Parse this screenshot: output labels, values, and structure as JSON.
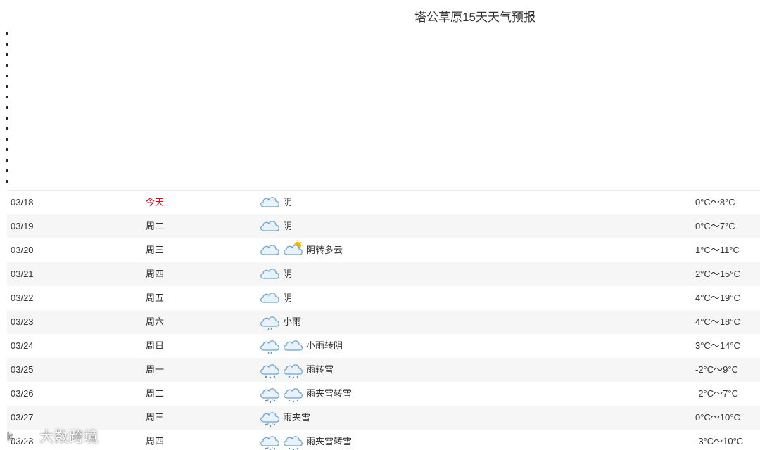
{
  "title": "塔公草原15天天气预报",
  "watermark": "大数跨境",
  "rows": [
    {
      "date": "03/18",
      "day": "今天",
      "today": true,
      "icons": [
        "cloud-icon"
      ],
      "weather": "阴",
      "temp": "0°C～8°C"
    },
    {
      "date": "03/19",
      "day": "周二",
      "icons": [
        "cloud-icon"
      ],
      "weather": "阴",
      "temp": "0°C～7°C"
    },
    {
      "date": "03/20",
      "day": "周三",
      "icons": [
        "cloud-icon",
        "sun-cloud-icon"
      ],
      "weather": "阴转多云",
      "temp": "1°C～11°C"
    },
    {
      "date": "03/21",
      "day": "周四",
      "icons": [
        "cloud-icon"
      ],
      "weather": "阴",
      "temp": "2°C～15°C"
    },
    {
      "date": "03/22",
      "day": "周五",
      "icons": [
        "cloud-icon"
      ],
      "weather": "阴",
      "temp": "4°C～19°C"
    },
    {
      "date": "03/23",
      "day": "周六",
      "icons": [
        "rain-icon"
      ],
      "weather": "小雨",
      "temp": "4°C～18°C"
    },
    {
      "date": "03/24",
      "day": "周日",
      "icons": [
        "rain-icon",
        "cloud-icon"
      ],
      "weather": "小雨转阴",
      "temp": "3°C～14°C"
    },
    {
      "date": "03/25",
      "day": "周一",
      "icons": [
        "snow-icon",
        "snow-icon"
      ],
      "weather": "雨转雪",
      "temp": "-2°C～9°C"
    },
    {
      "date": "03/26",
      "day": "周二",
      "icons": [
        "sleet-icon",
        "snow-icon"
      ],
      "weather": "雨夹雪转雪",
      "temp": "-2°C～7°C"
    },
    {
      "date": "03/27",
      "day": "周三",
      "icons": [
        "sleet-icon"
      ],
      "weather": "雨夹雪",
      "temp": "0°C～10°C"
    },
    {
      "date": "03/28",
      "day": "周四",
      "icons": [
        "sleet-icon",
        "snow-icon"
      ],
      "weather": "雨夹雪转雪",
      "temp": "-3°C～10°C"
    }
  ],
  "colors": {
    "today": "#d0021b",
    "cloud_fill": "#e8f2fa",
    "cloud_stroke": "#6f9fc4",
    "sun": "#f5b400",
    "drop": "#5b8fbd"
  }
}
